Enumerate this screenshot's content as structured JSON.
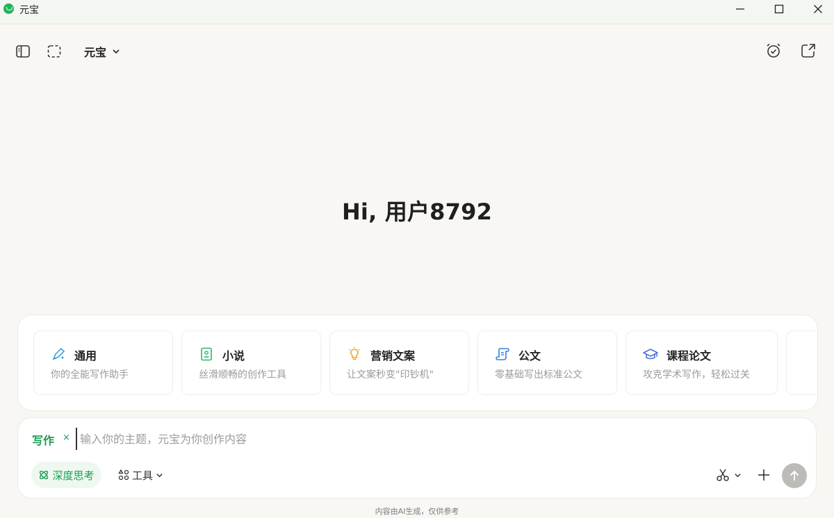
{
  "window": {
    "title": "元宝",
    "controls": {
      "minimize": "minimize-icon",
      "maximize": "maximize-icon",
      "close": "close-icon"
    }
  },
  "toolbar": {
    "model_name": "元宝",
    "icons": [
      "sidebar-toggle-icon",
      "screenshot-select-icon",
      "chevron-down-icon",
      "alarm-clock-icon",
      "new-chat-icon"
    ]
  },
  "greeting": "Hi, 用户8792",
  "cards": [
    {
      "title": "通用",
      "desc": "你的全能写作助手",
      "icon": "pen-icon",
      "color": "#3aa0e6"
    },
    {
      "title": "小说",
      "desc": "丝滑顺畅的创作工具",
      "icon": "book-icon",
      "color": "#2fb36a"
    },
    {
      "title": "营销文案",
      "desc": "让文案秒变\"印钞机\"",
      "icon": "lightbulb-icon",
      "color": "#f2a322"
    },
    {
      "title": "公文",
      "desc": "零基础写出标准公文",
      "icon": "scroll-icon",
      "color": "#3a7fe0"
    },
    {
      "title": "课程论文",
      "desc": "攻克学术写作，轻松过关",
      "icon": "graduation-cap-icon",
      "color": "#4d6fd8"
    }
  ],
  "input": {
    "mode_tag": "写作",
    "mode_close": "×",
    "placeholder": "输入你的主题，元宝为你创作内容",
    "deep_think_label": "深度思考",
    "tools_label": "工具",
    "accent": "#1a9d52"
  },
  "footer": "内容由AI生成，仅供参考"
}
